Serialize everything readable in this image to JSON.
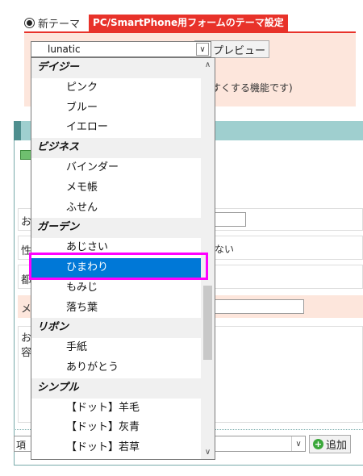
{
  "theme_section": {
    "radio_label": "新テーマ",
    "tag": "PC/SmartPhone用フォームのテーマ設定",
    "selected_theme": "lunatic",
    "preview_label": "プレビュー",
    "hint_text": "すくする機能です)"
  },
  "dropdown": {
    "groups": [
      {
        "label": "デイジー",
        "items": [
          "ピンク",
          "ブルー",
          "イエロー"
        ]
      },
      {
        "label": "ビジネス",
        "items": [
          "バインダー",
          "メモ帳",
          "ふせん"
        ]
      },
      {
        "label": "ガーデン",
        "items": [
          "あじさい",
          "ひまわり",
          "もみじ",
          "落ち葉"
        ]
      },
      {
        "label": "リボン",
        "items": [
          "手紙",
          "ありがとう"
        ]
      },
      {
        "label": "シンプル",
        "items": [
          "【ドット】羊毛",
          "【ドット】灰青",
          "【ドット】若草"
        ]
      }
    ],
    "selected": "ひまわり"
  },
  "form_background": {
    "row_chars": [
      "お",
      "性",
      "都",
      "メ",
      "お",
      "容"
    ],
    "gender_hint": "ない",
    "field_select_prefix": "項",
    "add_label": "追加"
  },
  "colors": {
    "accent_red": "#e8322a",
    "panel_pink": "#fde6dc",
    "header_teal": "#9fcfcf",
    "selection_blue": "#0078d7",
    "highlight_magenta": "#ff00ff"
  }
}
